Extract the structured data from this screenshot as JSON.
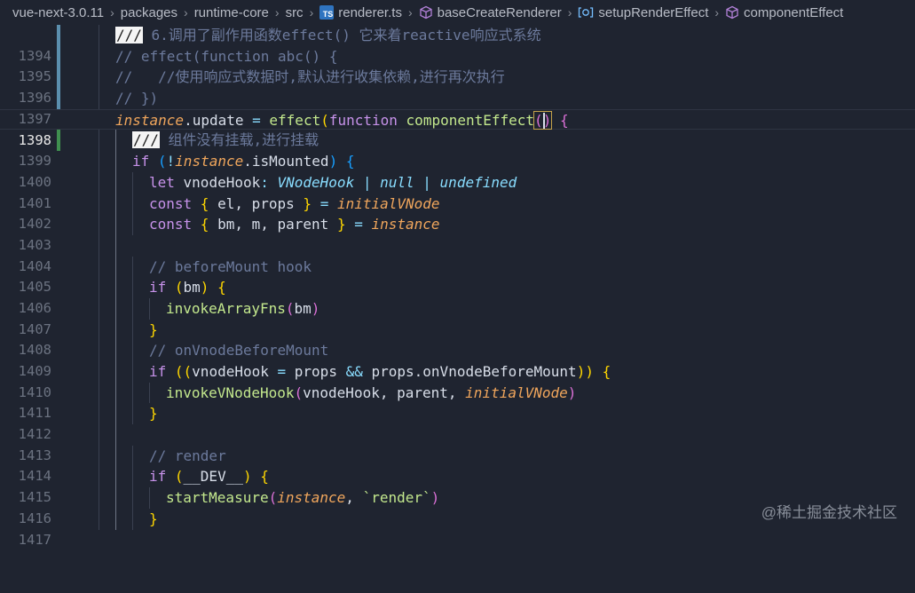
{
  "breadcrumb": {
    "items": [
      "vue-next-3.0.11",
      "packages",
      "runtime-core",
      "src",
      "renderer.ts",
      "baseCreateRenderer",
      "setupRenderEffect",
      "componentEffect"
    ],
    "ts_badge": "TS"
  },
  "editor": {
    "lines": [
      {
        "n": "1394",
        "tokens": [
          "///",
          " 6.调用了副作用函数effect() 它来着reactive响应式系统"
        ]
      },
      {
        "n": "1395",
        "tokens": [
          "// effect(function abc() {"
        ]
      },
      {
        "n": "1396",
        "tokens": [
          "//   //使用响应式数据时,默认进行收集依赖,进行再次执行"
        ]
      },
      {
        "n": "1397",
        "tokens": [
          "// })"
        ]
      },
      {
        "n": "1398",
        "tokens": [
          "instance",
          ".update",
          " = ",
          "effect",
          "(",
          "function",
          " ",
          "componentEffect",
          "(",
          ")",
          " {"
        ]
      },
      {
        "n": "1399",
        "tokens": [
          "///",
          " 组件没有挂载,进行挂载"
        ]
      },
      {
        "n": "1400",
        "tokens": [
          "if",
          " (",
          "!",
          "instance",
          ".isMounted",
          ") {"
        ]
      },
      {
        "n": "1401",
        "tokens": [
          "let",
          " vnodeHook",
          ": ",
          "VNodeHook",
          " | ",
          "null",
          " | ",
          "undefined"
        ]
      },
      {
        "n": "1402",
        "tokens": [
          "const",
          " { ",
          "el",
          ", ",
          "props",
          " } ",
          "=",
          " ",
          "initialVNode"
        ]
      },
      {
        "n": "1403",
        "tokens": [
          "const",
          " { ",
          "bm",
          ", ",
          "m",
          ", ",
          "parent",
          " } ",
          "=",
          " ",
          "instance"
        ]
      },
      {
        "n": "1404",
        "tokens": []
      },
      {
        "n": "1405",
        "tokens": [
          "// beforeMount hook"
        ]
      },
      {
        "n": "1406",
        "tokens": [
          "if",
          " (",
          "bm",
          ") {"
        ]
      },
      {
        "n": "1407",
        "tokens": [
          "invokeArrayFns",
          "(",
          "bm",
          ")"
        ]
      },
      {
        "n": "1408",
        "tokens": [
          "}"
        ]
      },
      {
        "n": "1409",
        "tokens": [
          "// onVnodeBeforeMount"
        ]
      },
      {
        "n": "1410",
        "tokens": [
          "if",
          " ((",
          "vnodeHook",
          " = ",
          "props",
          " && ",
          "props",
          ".onVnodeBeforeMount",
          ")) {"
        ]
      },
      {
        "n": "1411",
        "tokens": [
          "invokeVNodeHook",
          "(",
          "vnodeHook",
          ", ",
          "parent",
          ", ",
          "initialVNode",
          ")"
        ]
      },
      {
        "n": "1412",
        "tokens": [
          "}"
        ]
      },
      {
        "n": "1413",
        "tokens": []
      },
      {
        "n": "1414",
        "tokens": [
          "// render"
        ]
      },
      {
        "n": "1415",
        "tokens": [
          "if",
          " (",
          "__DEV__",
          ") {"
        ]
      },
      {
        "n": "1416",
        "tokens": [
          "startMeasure",
          "(",
          "instance",
          ", ",
          "`render`",
          ")"
        ]
      },
      {
        "n": "1417",
        "tokens": [
          "}"
        ]
      }
    ]
  },
  "watermark": "@稀土掘金技术社区",
  "colors": {
    "background": "#1f2430",
    "comment": "#6c7a9c",
    "keyword": "#c792ea",
    "function": "#c3e88d",
    "italic_var": "#f0a65c",
    "type": "#89ddff"
  },
  "icons": {
    "file": "typescript-file-icon",
    "class": "cube-icon",
    "method": "method-icon",
    "gutter": "lightbulb-icon"
  }
}
